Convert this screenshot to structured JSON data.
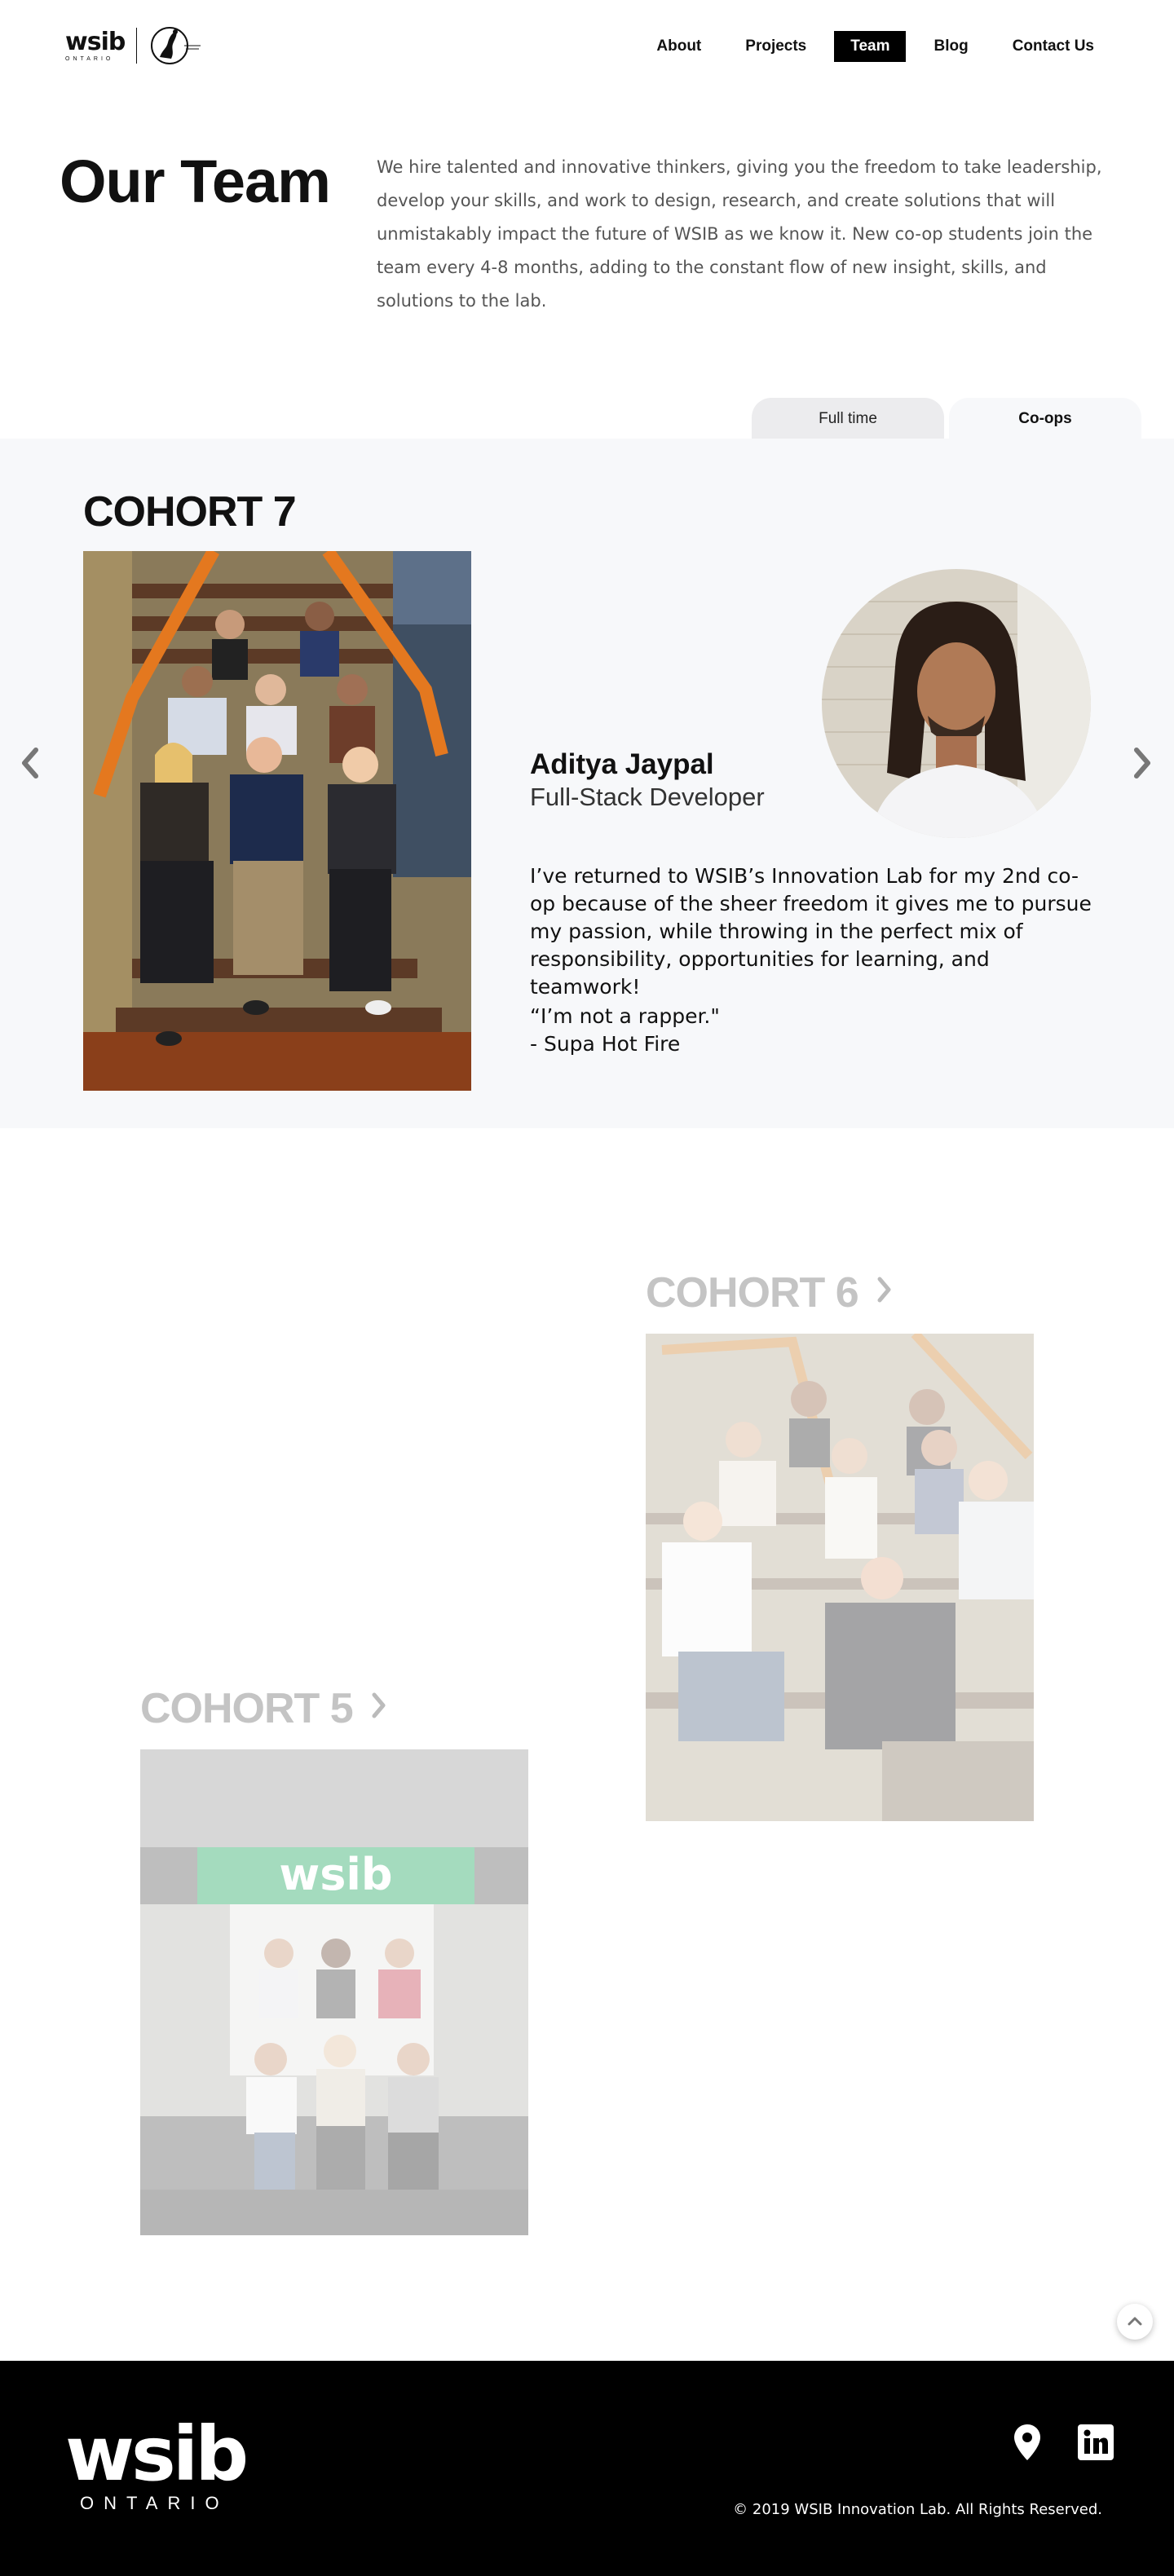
{
  "header": {
    "logo": {
      "wordmark": "wsib",
      "submark": "ONTARIO"
    },
    "nav": [
      {
        "label": "About",
        "active": false
      },
      {
        "label": "Projects",
        "active": false
      },
      {
        "label": "Team",
        "active": true
      },
      {
        "label": "Blog",
        "active": false
      },
      {
        "label": "Contact Us",
        "active": false
      }
    ]
  },
  "intro": {
    "title": "Our Team",
    "body": "We hire talented and innovative thinkers, giving you the freedom to take leadership, develop your skills, and work to design, research, and create solutions that will unmistakably impact the future of WSIB as we know it. New co-op students join the team every 4-8 months, adding to the constant flow of new insight, skills, and solutions to the lab."
  },
  "tabs": [
    {
      "label": "Full time",
      "selected": false
    },
    {
      "label": "Co-ops",
      "selected": true
    }
  ],
  "current_cohort": {
    "title": "COHORT 7",
    "member": {
      "name": "Aditya Jaypal",
      "role": "Full-Stack Developer",
      "bio": "I’ve returned to WSIB’s Innovation Lab for my 2nd co-op because of the sheer freedom it gives me to pursue my passion, while throwing in the perfect mix of responsibility, opportunities for learning, and teamwork!",
      "quote_line1": "“I’m not a rapper.\"",
      "quote_line2": "- Supa Hot Fire"
    },
    "icons": {
      "prev": "chevron-left-icon",
      "next": "chevron-right-icon"
    }
  },
  "past_cohorts": [
    {
      "title": "COHORT 6"
    },
    {
      "title": "COHORT 5"
    }
  ],
  "footer": {
    "logo": {
      "wordmark": "wsib",
      "submark": "ONTARIO"
    },
    "copyright": "© 2019 WSIB Innovation Lab. All Rights Reserved.",
    "icons": [
      "map-pin-icon",
      "linkedin-icon"
    ]
  },
  "colors": {
    "panel_bg": "#f7f8fa",
    "tab_inactive": "#ececee",
    "nav_active_bg": "#000000",
    "faded_heading": "#c4c4c4",
    "footer_bg": "#000000"
  }
}
